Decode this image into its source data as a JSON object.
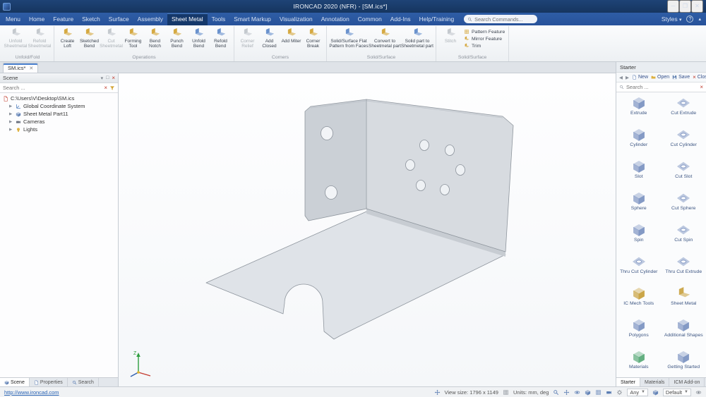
{
  "window": {
    "title": "IRONCAD 2020 (NFR) - [SM.ics*]"
  },
  "menu": {
    "tabs": [
      "Menu",
      "Home",
      "Feature",
      "Sketch",
      "Surface",
      "Assembly",
      "Sheet Metal",
      "Tools",
      "Smart Markup",
      "Visualization",
      "Annotation",
      "Common",
      "Add-Ins",
      "Help/Training"
    ],
    "search_placeholder": "Search Commands...",
    "styles_label": "Styles"
  },
  "ribbon": {
    "groups": [
      {
        "label": "Unfold/Fold",
        "items": [
          {
            "label": "Unfold Sheetmetal"
          },
          {
            "label": "Refold Sheetmetal"
          }
        ]
      },
      {
        "label": "Operations",
        "items": [
          {
            "label": "Create Loft"
          },
          {
            "label": "Sketched Bend"
          },
          {
            "label": "Cut Sheetmetal"
          },
          {
            "label": "Forming Tool"
          },
          {
            "label": "Bend Notch"
          },
          {
            "label": "Punch Bend"
          },
          {
            "label": "Unfold Bend"
          },
          {
            "label": "Refold Bend"
          }
        ]
      },
      {
        "label": "Corners",
        "items": [
          {
            "label": "Corner Relief"
          },
          {
            "label": "Add Closed"
          },
          {
            "label": "Add Miter"
          },
          {
            "label": "Corner Break"
          }
        ]
      },
      {
        "label": "Solid/Surface",
        "items": [
          {
            "label": "Solid/Surface Flat Pattern from Faces"
          },
          {
            "label": "Convert to Sheetmetal part"
          },
          {
            "label": "Solid part to Sheetmetal part"
          }
        ]
      },
      {
        "label": "Solid/Surface",
        "items": [
          {
            "label": "Stitch"
          },
          {
            "label": "Pattern Feature"
          },
          {
            "label": "Mirror Feature"
          },
          {
            "label": "Trim"
          }
        ]
      }
    ]
  },
  "document": {
    "tab": "SM.ics*"
  },
  "scene": {
    "title": "Scene",
    "search_placeholder": "Search ...",
    "items": [
      {
        "label": "C:\\Users\\V\\Desktop\\SM.ics"
      },
      {
        "label": "Global Coordinate System"
      },
      {
        "label": "Sheet Metal Part11"
      },
      {
        "label": "Cameras"
      },
      {
        "label": "Lights"
      }
    ],
    "tabs": [
      "Scene",
      "Properties",
      "Search"
    ]
  },
  "viewport": {
    "triad_z": "Z"
  },
  "catalog": {
    "title": "Starter",
    "toolbar": [
      {
        "label": "New"
      },
      {
        "label": "Open"
      },
      {
        "label": "Save"
      },
      {
        "label": "Close"
      }
    ],
    "search_placeholder": "Search ...",
    "items": [
      {
        "label": "Extrude"
      },
      {
        "label": "Cut Extrude"
      },
      {
        "label": "Cylinder"
      },
      {
        "label": "Cut Cylinder"
      },
      {
        "label": "Slot"
      },
      {
        "label": "Cut Slot"
      },
      {
        "label": "Sphere"
      },
      {
        "label": "Cut Sphere"
      },
      {
        "label": "Spin"
      },
      {
        "label": "Cut Spin"
      },
      {
        "label": "Thru Cut Cylinder"
      },
      {
        "label": "Thru Cut Extrude"
      },
      {
        "label": "IC Mech Tools"
      },
      {
        "label": "Sheet Metal"
      },
      {
        "label": "Polygons"
      },
      {
        "label": "Additional Shapes"
      },
      {
        "label": "Materials"
      },
      {
        "label": "Getting Started"
      }
    ],
    "tabs": [
      "Starter",
      "Materials",
      "ICM Add-on"
    ]
  },
  "status": {
    "link": "http://www.ironcad.com",
    "view_size": "View size: 1796 x 1149",
    "units": "Units: mm, deg",
    "selection_filter": "Any",
    "render_style": "Default"
  }
}
